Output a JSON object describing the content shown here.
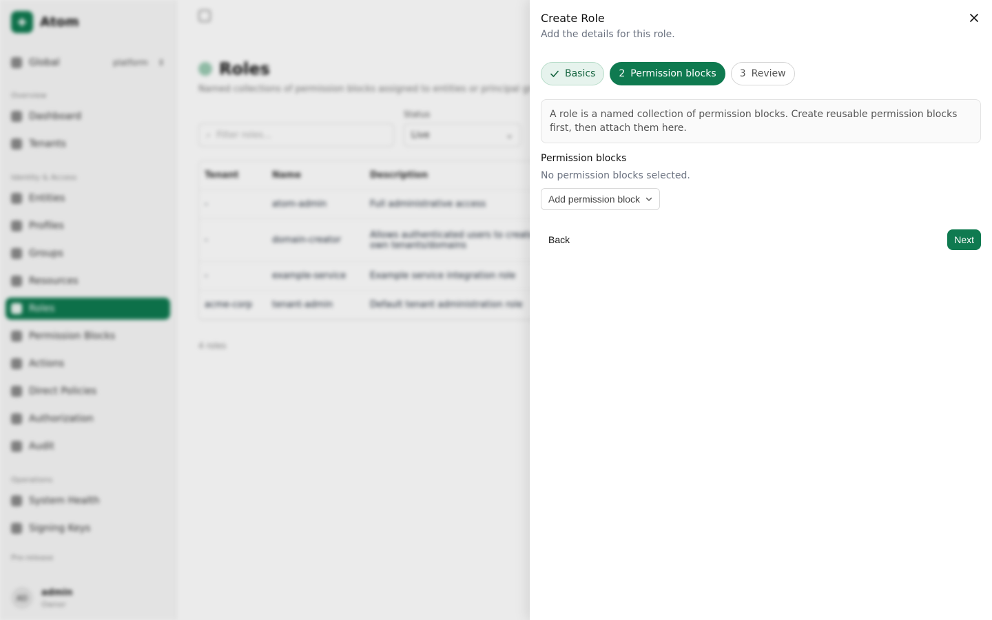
{
  "background": {
    "brand": "Atom",
    "brand_icon": "atom-logo-icon",
    "scope": {
      "label": "Global",
      "user": "platform"
    },
    "sections": [
      {
        "title": "Overview",
        "items": [
          "Dashboard",
          "Tenants"
        ]
      },
      {
        "title": "Identity & Access",
        "items": [
          "Entities",
          "Profiles",
          "Groups",
          "Resources",
          "Roles",
          "Permission Blocks",
          "Actions",
          "Direct Policies",
          "Authorization",
          "Audit"
        ]
      },
      {
        "title": "Operations",
        "items": [
          "System Health",
          "Signing Keys"
        ]
      },
      {
        "title": "Pre-release",
        "items": []
      }
    ],
    "active_item": "Roles",
    "user": {
      "initials": "AD",
      "name": "admin",
      "role": "Owner"
    },
    "page": {
      "title": "Roles",
      "subtitle": "Named collections of permission blocks assigned to entities or principal groups.",
      "filter_placeholder": "Filter roles...",
      "status_label": "Status",
      "status_value": "Live",
      "columns": [
        "Tenant",
        "Name",
        "Description"
      ],
      "rows": [
        {
          "tenant": "-",
          "name": "atom-admin",
          "description": "Full administrative access"
        },
        {
          "tenant": "-",
          "name": "domain-creator",
          "description": "Allows authenticated users to create their own tenants/domains"
        },
        {
          "tenant": "-",
          "name": "example-service",
          "description": "Example service integration role"
        },
        {
          "tenant": "acme-corp",
          "name": "tenant-admin",
          "description": "Default tenant administration role"
        }
      ],
      "count": "4 roles"
    }
  },
  "drawer": {
    "title": "Create Role",
    "subtitle": "Add the details for this role.",
    "close_icon": "close-icon",
    "steps": [
      {
        "marker": "✓",
        "label": "Basics",
        "state": "done"
      },
      {
        "marker": "2",
        "label": "Permission blocks",
        "state": "current"
      },
      {
        "marker": "3",
        "label": "Review",
        "state": "upcoming"
      }
    ],
    "info": "A role is a named collection of permission blocks. Create reusable permission blocks first, then attach them here.",
    "section_label": "Permission blocks",
    "empty_text": "No permission blocks selected.",
    "add_button": "Add permission block",
    "back_label": "Back",
    "next_label": "Next"
  },
  "colors": {
    "accent": "#0f7a50",
    "accent_soft": "#e6f3ed"
  }
}
